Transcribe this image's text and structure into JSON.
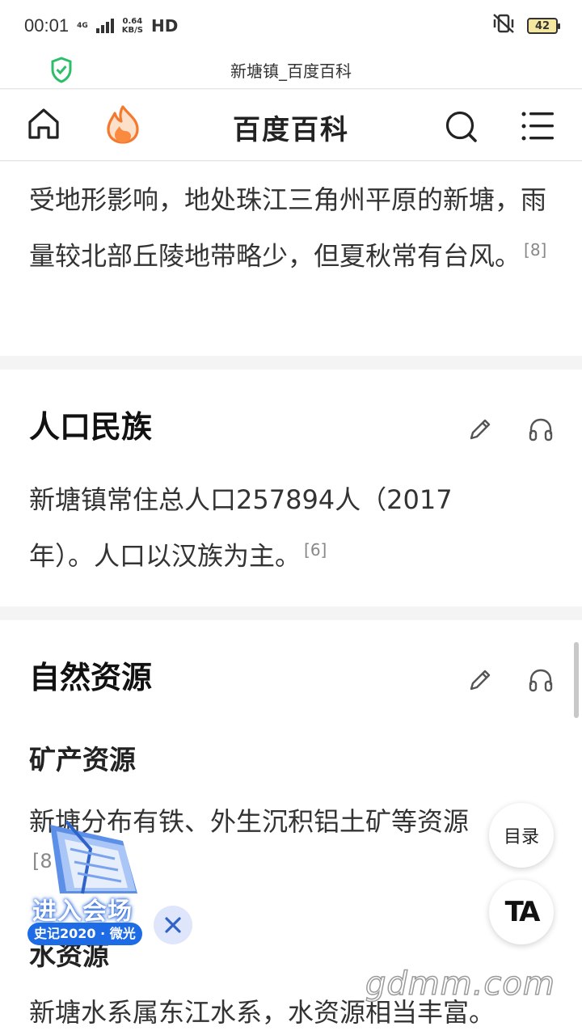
{
  "status_bar": {
    "time": "00:01",
    "network": "4G",
    "speed_value": "0.64",
    "speed_unit": "KB/S",
    "hd": "HD",
    "battery": "42"
  },
  "browser": {
    "page_title": "新塘镇_百度百科"
  },
  "header": {
    "title": "百度百科"
  },
  "climate": {
    "text": "受地形影响，地处珠江三角州平原的新塘，雨量较北部丘陵地带略少，但夏秋常有台风。",
    "ref": "[8]"
  },
  "population": {
    "heading": "人口民族",
    "text": "新塘镇常住总人口257894人（2017年）。人口以汉族为主。",
    "ref": "[6]"
  },
  "resources": {
    "heading": "自然资源",
    "mineral_heading": "矿产资源",
    "mineral_text": "新塘分布有铁、外生沉积铝土矿等资源",
    "mineral_ref": "[8",
    "water_heading": "水资源",
    "water_text": "新塘水系属东江水系，水资源相当丰富。"
  },
  "floating": {
    "toc_label": "目录",
    "ta_label": "TA"
  },
  "promo": {
    "main": "进入会场",
    "sub": "史记2020 · 微光"
  },
  "watermark": "gdmm.com"
}
